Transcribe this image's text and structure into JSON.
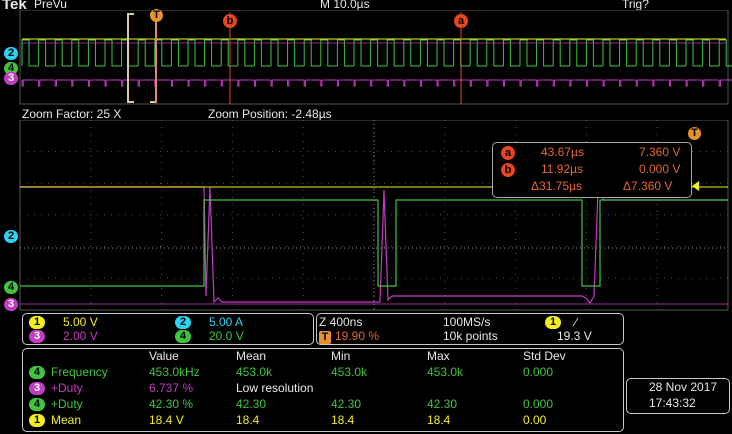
{
  "header": {
    "logo": "Tek",
    "mode": "PreVu",
    "timebase": "M 10.0µs",
    "trigger_status": "Trig?"
  },
  "markers": {
    "trigger": "T",
    "cursor_a": "a",
    "cursor_b": "b"
  },
  "zoom": {
    "factor_label": "Zoom Factor: 25 X",
    "position_label": "Zoom Position: -2.48µs"
  },
  "channels": {
    "ch1": {
      "num": "1",
      "scale": "5.00 V",
      "color": "#f3ee1e"
    },
    "ch2": {
      "num": "2",
      "scale": "5.00 A",
      "color": "#2ad3f2"
    },
    "ch3": {
      "num": "3",
      "scale": "2.00 V",
      "color": "#c43bc4"
    },
    "ch4": {
      "num": "4",
      "scale": "20.0 V",
      "color": "#3fc43f"
    }
  },
  "cursor_readout": {
    "a_time": "43.67µs",
    "a_value": "7.360 V",
    "b_time": "11.92µs",
    "b_value": "0.000 V",
    "delta_time": "Δ31.75µs",
    "delta_value": "Δ7.360 V"
  },
  "acquisition": {
    "zoom_timebase": "Z 400ns",
    "trigger_pos": "19.90 %",
    "sample_rate": "100MS/s",
    "record_length": "10k points",
    "trigger_channel": "1",
    "trigger_slope": "∕",
    "trigger_level": "19.3 V"
  },
  "measurements": {
    "headers": [
      "Value",
      "Mean",
      "Min",
      "Max",
      "Std Dev"
    ],
    "rows": [
      {
        "ch": "4",
        "name": "Frequency",
        "value": "453.0kHz",
        "mean": "453.0k",
        "min": "453.0k",
        "max": "453.0k",
        "std": "0.000"
      },
      {
        "ch": "3",
        "name": "+Duty",
        "value": "6.737 %",
        "mean": "Low resolution",
        "min": "",
        "max": "",
        "std": ""
      },
      {
        "ch": "4",
        "name": "+Duty",
        "value": "42.30 %",
        "mean": "42.30",
        "min": "42.30",
        "max": "42.30",
        "std": "0.000"
      },
      {
        "ch": "1",
        "name": "Mean",
        "value": "18.4 V",
        "mean": "18.4",
        "min": "18.4",
        "max": "18.4",
        "std": "0.00"
      }
    ]
  },
  "datetime": {
    "date": "28 Nov  2017",
    "time": "17:43:32"
  }
}
